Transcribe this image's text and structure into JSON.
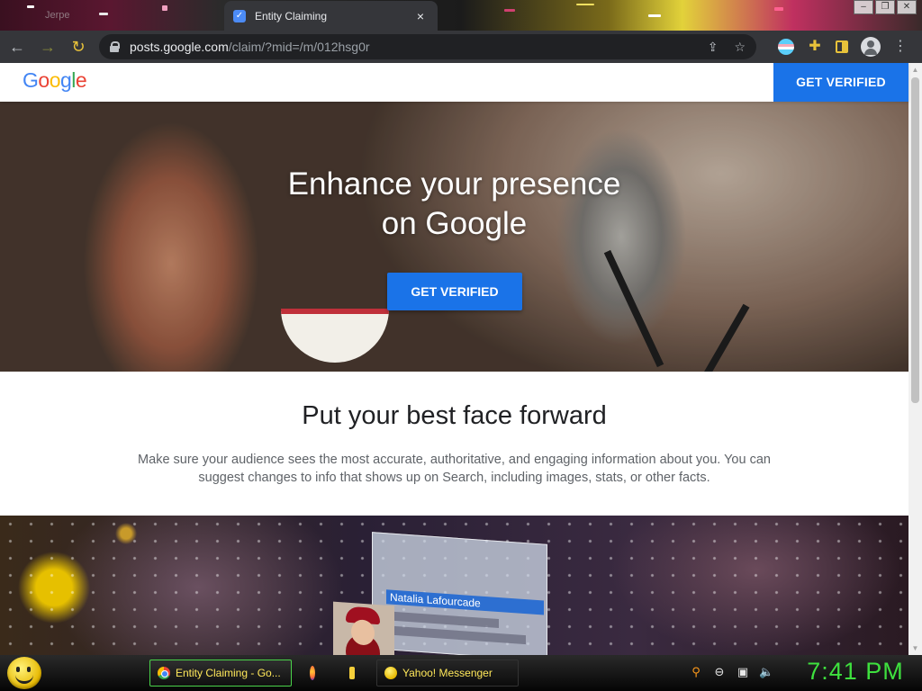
{
  "browser": {
    "inactive_tab_title": "Jerpe",
    "active_tab_title": "Entity Claiming",
    "tab_close_glyph": "×",
    "url_host": "posts.google.com",
    "url_path": "/claim/?mid=/m/012hsg0r"
  },
  "header": {
    "logo_letters": [
      "G",
      "o",
      "o",
      "g",
      "l",
      "e"
    ],
    "cta_label": "GET VERIFIED"
  },
  "hero": {
    "title_line1": "Enhance your presence",
    "title_line2": "on Google",
    "cta_label": "GET VERIFIED"
  },
  "section": {
    "heading": "Put your best face forward",
    "body": "Make sure your audience sees the most accurate, authoritative, and engaging information about you. You can suggest changes to info that shows up on Search, including images, stats, or other facts."
  },
  "photo_card": {
    "name": "Natalia Lafourcade"
  },
  "taskbar": {
    "items": [
      {
        "label": "Entity Claiming - Go...",
        "icon": "chrome-icon"
      },
      {
        "label": "",
        "icon": "firefox-icon"
      },
      {
        "label": "",
        "icon": "folder-icon"
      },
      {
        "label": "Yahoo! Messenger",
        "icon": "yahoo-messenger-icon"
      }
    ],
    "clock": "7:41 PM"
  },
  "colors": {
    "accent_blue": "#1a73e8",
    "clock_green": "#3ee03e",
    "taskbar_text": "#ffe85a"
  }
}
